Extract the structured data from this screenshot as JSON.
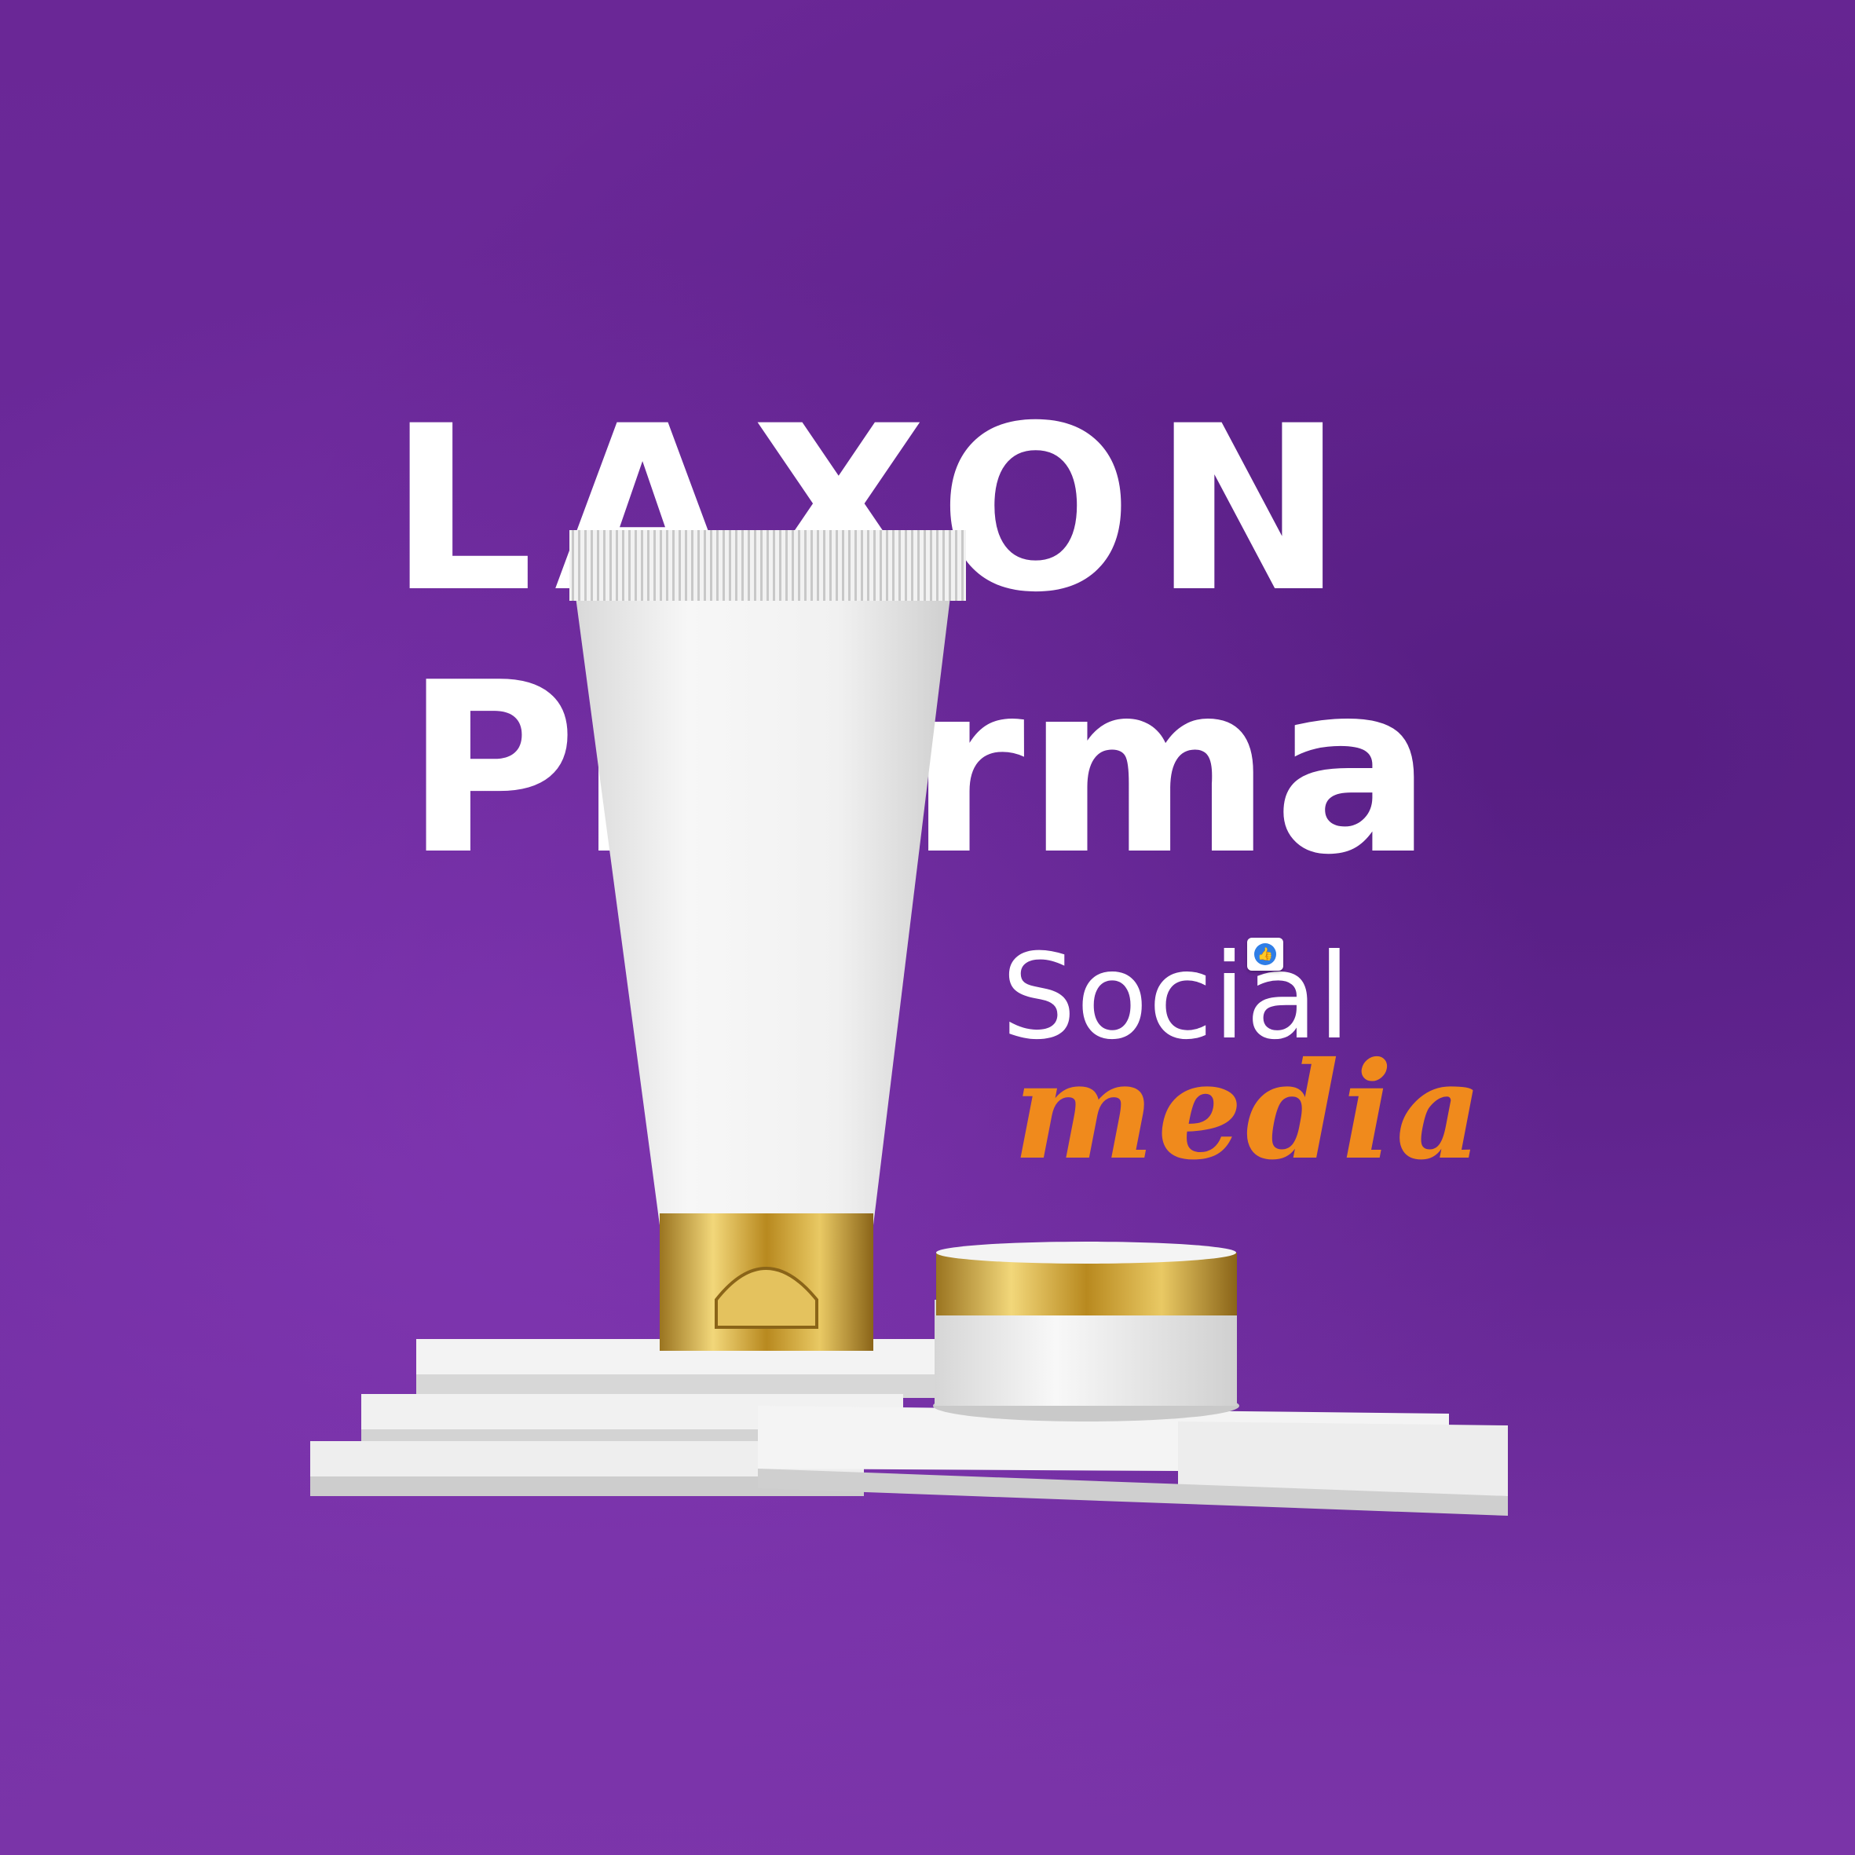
{
  "brand": {
    "line1": "LAXON",
    "line2": "Pharma"
  },
  "tagline": {
    "social": "Social",
    "media": "media"
  },
  "icons": {
    "like": "thumbs-up-icon",
    "like_glyph": "👍"
  },
  "colors": {
    "background": "#6a2796",
    "wordmark": "#ffffff",
    "media_accent": "#f08a1c",
    "like_badge": "#2f7ee6",
    "gold": "#c9a13a"
  }
}
